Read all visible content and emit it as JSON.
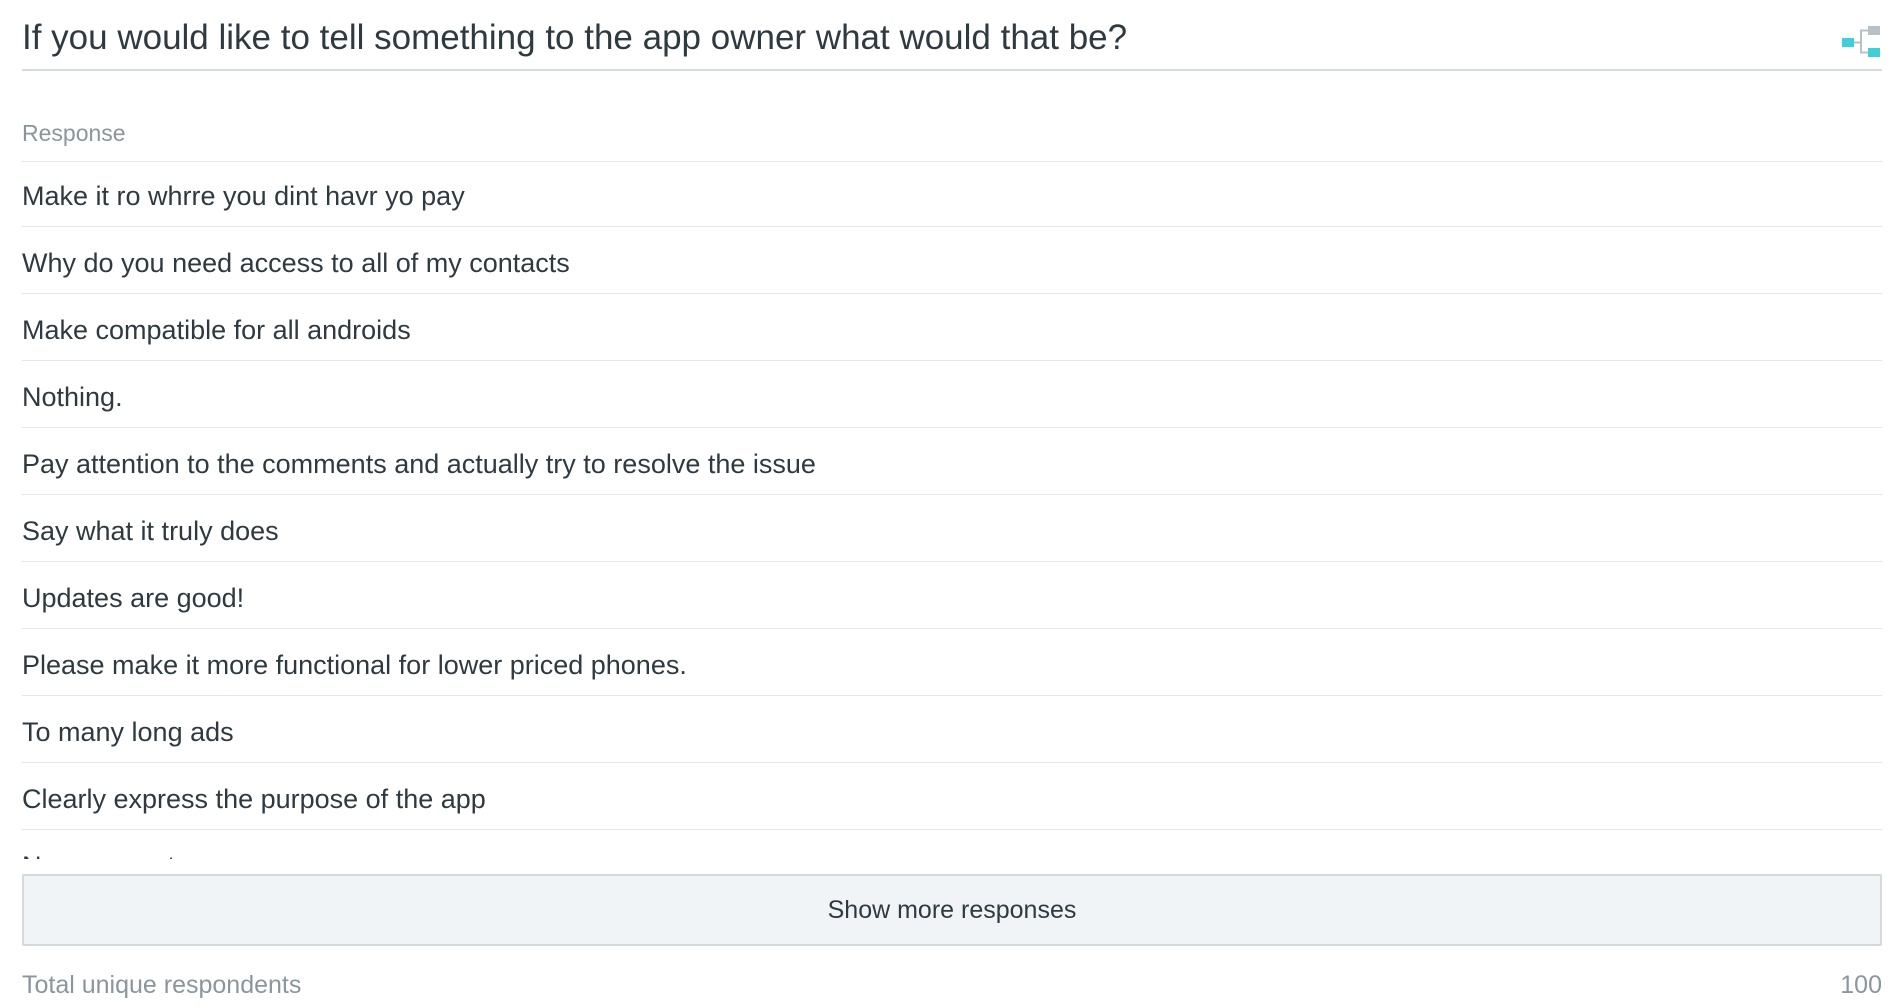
{
  "question": {
    "title": "If you would like to tell something to the app owner what would that be?",
    "icon": "branch-logic-icon"
  },
  "table": {
    "column_header": "Response",
    "responses": [
      "Make it ro whrre you dint havr yo pay",
      "Why do you need access to all of my contacts",
      "Make compatible for all androids",
      "Nothing.",
      "Pay attention to the comments and actually try to resolve the issue",
      "Say what it truly does",
      "Updates are good!",
      "Please make it more functional for lower priced phones.",
      "To many long ads",
      "Clearly express the purpose of the app",
      "No comment"
    ]
  },
  "actions": {
    "show_more_label": "Show more responses"
  },
  "footer": {
    "label": "Total unique respondents",
    "value": "100"
  },
  "colors": {
    "accent": "#3fcfd6",
    "icon_gray": "#b9c1c6",
    "text": "#2f3a40",
    "muted_text": "#8a969c"
  }
}
